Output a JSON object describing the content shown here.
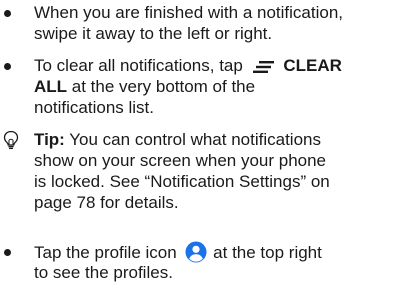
{
  "items": [
    {
      "lines": [
        "When you are finished with a notification,",
        "swipe it away to the left or right."
      ]
    },
    {
      "pre": "To clear all notifications, tap",
      "icon": "clear-all-icon",
      "bold": "CLEAR",
      "line2_bold": "ALL",
      "line2_rest": " at the very bottom of the",
      "line3": "notifications list."
    }
  ],
  "tip": {
    "icon": "lightbulb-icon",
    "label": "Tip:",
    "line1_rest": " You can control what notifications",
    "line2": "show on your screen when your phone",
    "line3": "is locked. See “Notification Settings” on",
    "line4": "page 78 for details."
  },
  "profile_item": {
    "pre": "Tap the profile icon",
    "icon": "profile-icon",
    "post": " at the top right",
    "line2": "to see the profiles.",
    "icon_color": "#1a73e8"
  }
}
